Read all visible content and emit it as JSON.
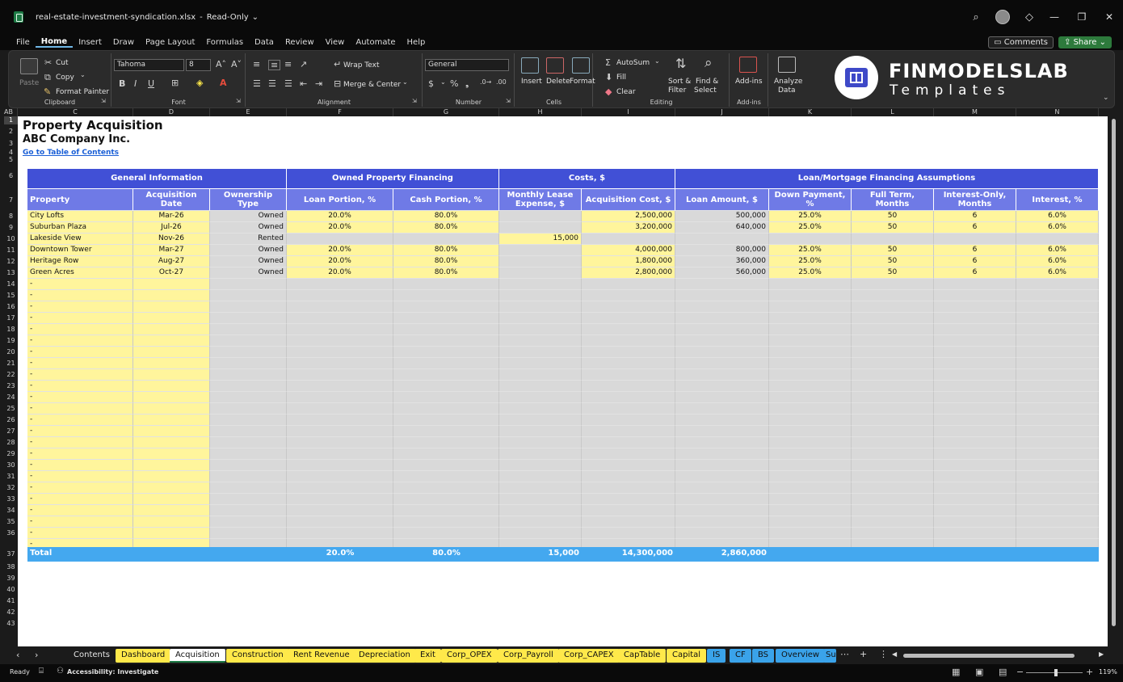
{
  "window": {
    "filename": "real-estate-investment-syndication.xlsx",
    "mode": "Read-Only"
  },
  "menu": {
    "items": [
      "File",
      "Home",
      "Insert",
      "Draw",
      "Page Layout",
      "Formulas",
      "Data",
      "Review",
      "View",
      "Automate",
      "Help"
    ],
    "comments": "Comments",
    "share": "Share"
  },
  "ribbon": {
    "paste": "Paste",
    "cut": "Cut",
    "copy": "Copy",
    "format_painter": "Format Painter",
    "clipboard": "Clipboard",
    "font_name": "Tahoma",
    "font_size": "8",
    "font": "Font",
    "wrap_text": "Wrap Text",
    "merge_center": "Merge & Center",
    "alignment": "Alignment",
    "number_format": "General",
    "number": "Number",
    "insert": "Insert",
    "delete": "Delete",
    "format": "Format",
    "cells": "Cells",
    "autosum": "AutoSum",
    "fill": "Fill",
    "clear": "Clear",
    "sort_filter_1": "Sort &",
    "sort_filter_2": "Filter",
    "find_select_1": "Find &",
    "find_select_2": "Select",
    "editing": "Editing",
    "addins": "Add-ins",
    "addins_group": "Add-ins",
    "analyze_1": "Analyze",
    "analyze_2": "Data"
  },
  "brand": {
    "name": "FINMODELSLAB",
    "sub": "Templates"
  },
  "columns": [
    "AB",
    "C",
    "D",
    "E",
    "F",
    "G",
    "H",
    "I",
    "J",
    "K",
    "L",
    "M",
    "N"
  ],
  "rows": [
    "1",
    "2",
    "3",
    "4",
    "5",
    "6",
    "7",
    "8",
    "9",
    "10",
    "11",
    "12",
    "13",
    "14",
    "15",
    "16",
    "17",
    "18",
    "19",
    "20",
    "21",
    "22",
    "23",
    "24",
    "25",
    "26",
    "27",
    "28",
    "29",
    "30",
    "31",
    "32",
    "33",
    "34",
    "35",
    "36",
    "37",
    "38",
    "39",
    "40",
    "41",
    "42",
    "43"
  ],
  "sheet": {
    "title": "Property Acquisition",
    "company": "ABC Company Inc.",
    "toc_link": "Go to Table of Contents",
    "group_headers": [
      "General Information",
      "Owned Property Financing",
      "Costs, $",
      "Loan/Mortgage Financing Assumptions"
    ],
    "col_headers": [
      "Property",
      "Acquisition Date",
      "Ownership Type",
      "Loan Portion, %",
      "Cash Portion, %",
      "Monthly Lease Expense, $",
      "Acquisition Cost, $",
      "Loan Amount, $",
      "Down Payment, %",
      "Full Term, Months",
      "Interest-Only, Months",
      "Interest, %"
    ],
    "rows": [
      [
        "City Lofts",
        "Mar-26",
        "Owned",
        "20.0%",
        "80.0%",
        "",
        "2,500,000",
        "500,000",
        "25.0%",
        "50",
        "6",
        "6.0%"
      ],
      [
        "Suburban Plaza",
        "Jul-26",
        "Owned",
        "20.0%",
        "80.0%",
        "",
        "3,200,000",
        "640,000",
        "25.0%",
        "50",
        "6",
        "6.0%"
      ],
      [
        "Lakeside View",
        "Nov-26",
        "Rented",
        "",
        "",
        "15,000",
        "",
        "",
        "",
        "",
        "",
        ""
      ],
      [
        "Downtown Tower",
        "Mar-27",
        "Owned",
        "20.0%",
        "80.0%",
        "",
        "4,000,000",
        "800,000",
        "25.0%",
        "50",
        "6",
        "6.0%"
      ],
      [
        "Heritage Row",
        "Aug-27",
        "Owned",
        "20.0%",
        "80.0%",
        "",
        "1,800,000",
        "360,000",
        "25.0%",
        "50",
        "6",
        "6.0%"
      ],
      [
        "Green Acres",
        "Oct-27",
        "Owned",
        "20.0%",
        "80.0%",
        "",
        "2,800,000",
        "560,000",
        "25.0%",
        "50",
        "6",
        "6.0%"
      ]
    ],
    "empty_marker": "-",
    "total": {
      "label": "Total",
      "loan_portion": "20.0%",
      "cash_portion": "80.0%",
      "lease": "15,000",
      "cost": "14,300,000",
      "loan_amount": "2,860,000"
    }
  },
  "tabs": [
    {
      "label": "Contents",
      "style": "plain"
    },
    {
      "label": "Dashboard",
      "style": "yellow"
    },
    {
      "label": "Acquisition",
      "style": "active"
    },
    {
      "label": "Construction",
      "style": "yellow"
    },
    {
      "label": "Rent Revenue",
      "style": "yellow"
    },
    {
      "label": "Depreciation",
      "style": "yellow"
    },
    {
      "label": "Exit",
      "style": "yellow"
    },
    {
      "label": "Corp_OPEX",
      "style": "yellow"
    },
    {
      "label": "Corp_Payroll",
      "style": "yellow"
    },
    {
      "label": "Corp_CAPEX",
      "style": "yellow"
    },
    {
      "label": "CapTable",
      "style": "yellow"
    },
    {
      "label": "Capital",
      "style": "yellow"
    },
    {
      "label": "IS",
      "style": "blue"
    },
    {
      "label": "CF",
      "style": "blue"
    },
    {
      "label": "BS",
      "style": "blue"
    },
    {
      "label": "Overview",
      "style": "blue"
    },
    {
      "label": "Su",
      "style": "blue"
    }
  ],
  "status": {
    "ready": "Ready",
    "accessibility": "Accessibility: Investigate",
    "zoom": "119%"
  }
}
